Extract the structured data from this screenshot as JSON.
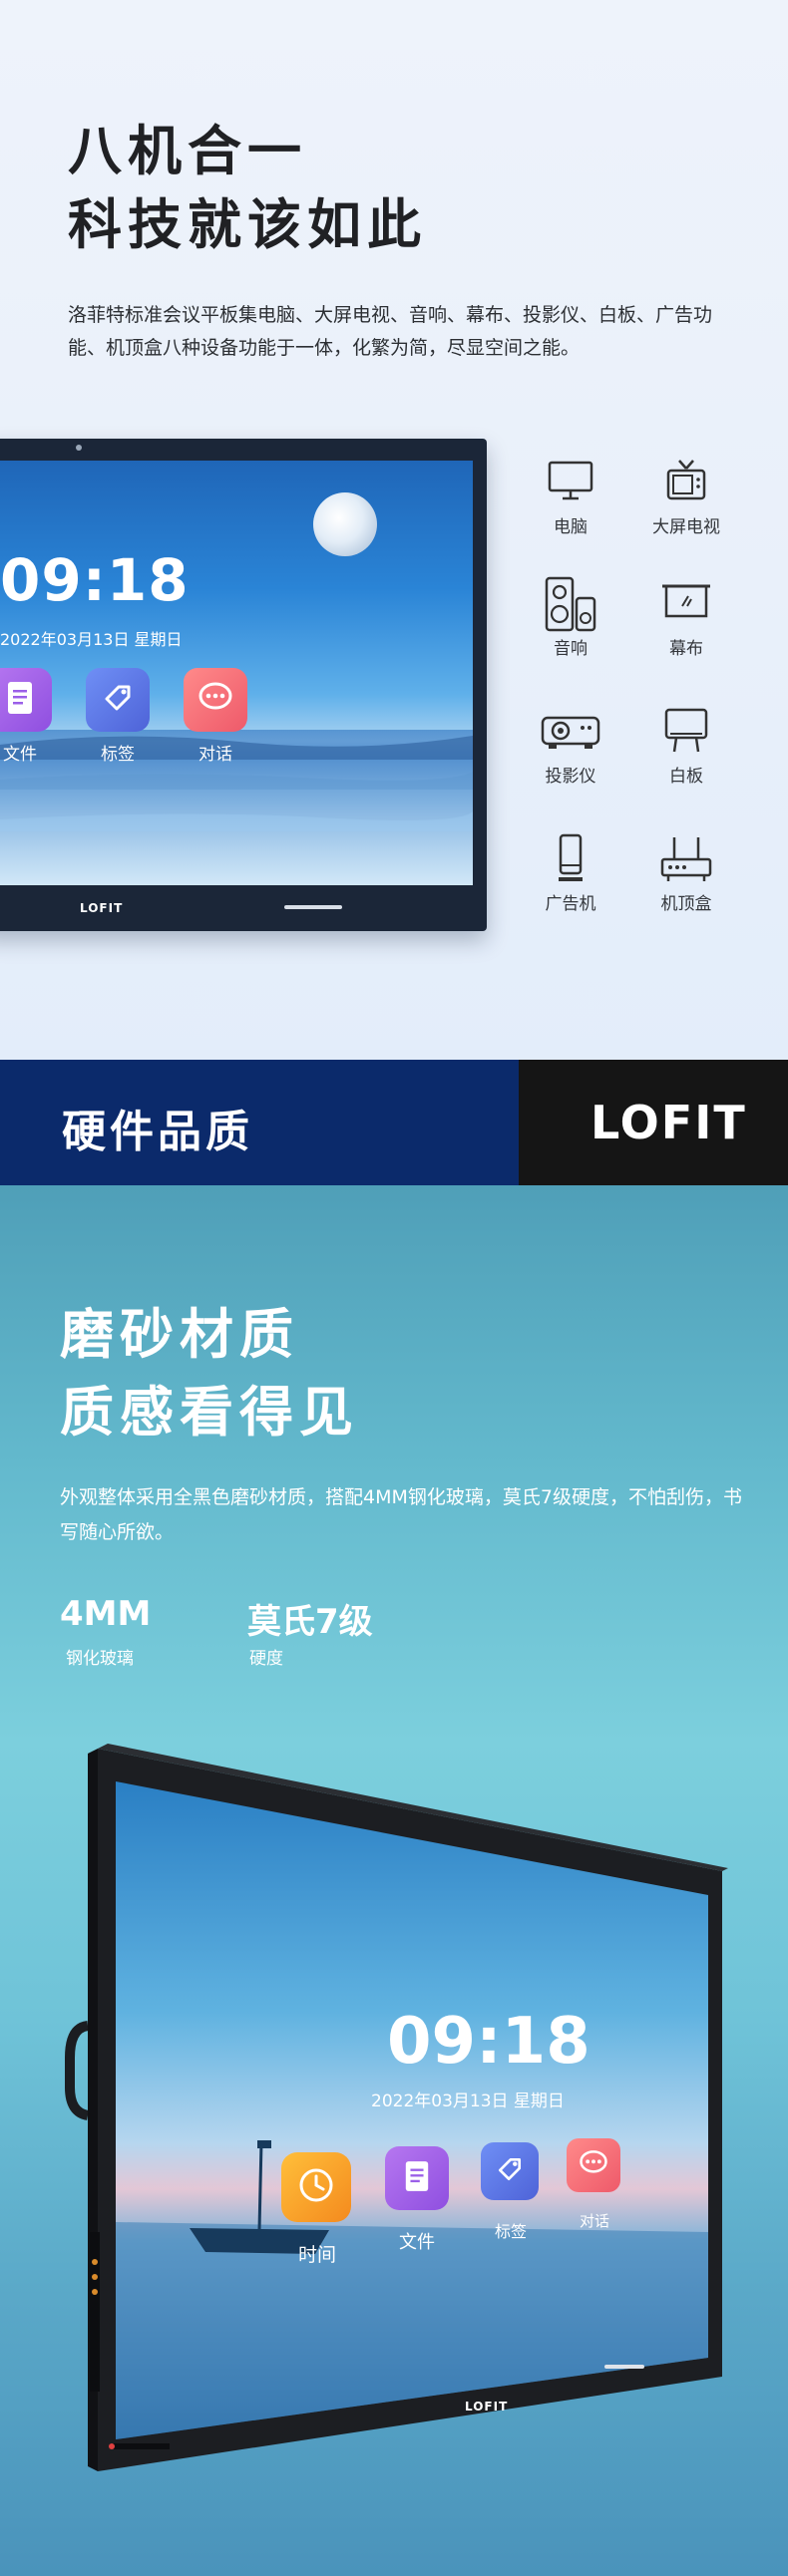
{
  "section1": {
    "title_line1": "八机合一",
    "title_line2": "科技就该如此",
    "description": "洛菲特标准会议平板集电脑、大屏电视、音响、幕布、投影仪、白板、广告功能、机顶盒八种设备功能于一体，化繁为简，尽显空间之能。",
    "screen": {
      "time": "09:18",
      "date": "2022年03月13日  星期日",
      "apps": [
        {
          "label": "文件",
          "icon": "file-icon"
        },
        {
          "label": "标签",
          "icon": "tag-icon"
        },
        {
          "label": "对话",
          "icon": "chat-icon"
        }
      ],
      "logo": "LOFIT"
    },
    "devices": [
      {
        "label": "电脑",
        "icon": "monitor-icon"
      },
      {
        "label": "大屏电视",
        "icon": "tv-icon"
      },
      {
        "label": "音响",
        "icon": "speaker-icon"
      },
      {
        "label": "幕布",
        "icon": "screen-curtain-icon"
      },
      {
        "label": "投影仪",
        "icon": "projector-icon"
      },
      {
        "label": "白板",
        "icon": "whiteboard-icon"
      },
      {
        "label": "广告机",
        "icon": "phone-kiosk-icon"
      },
      {
        "label": "机顶盒",
        "icon": "router-box-icon"
      }
    ]
  },
  "banner": {
    "title": "硬件品质",
    "brand": "LOFIT",
    "colors": {
      "left": "#0b2a6b",
      "right": "#151515"
    }
  },
  "section3": {
    "title_line1": "磨砂材质",
    "title_line2": "质感看得见",
    "description": "外观整体采用全黑色磨砂材质，搭配4MM钢化玻璃，莫氏7级硬度，不怕刮伤，书写随心所欲。",
    "specs": [
      {
        "value": "4MM",
        "label": "钢化玻璃"
      },
      {
        "value": "莫氏7级",
        "label": "硬度"
      }
    ],
    "screen": {
      "time": "09:18",
      "date": "2022年03月13日  星期日",
      "apps": [
        {
          "label": "时间",
          "icon": "clock-icon"
        },
        {
          "label": "文件",
          "icon": "file-icon"
        },
        {
          "label": "标签",
          "icon": "tag-icon"
        },
        {
          "label": "对话",
          "icon": "chat-icon"
        }
      ],
      "logo": "LOFIT"
    }
  }
}
